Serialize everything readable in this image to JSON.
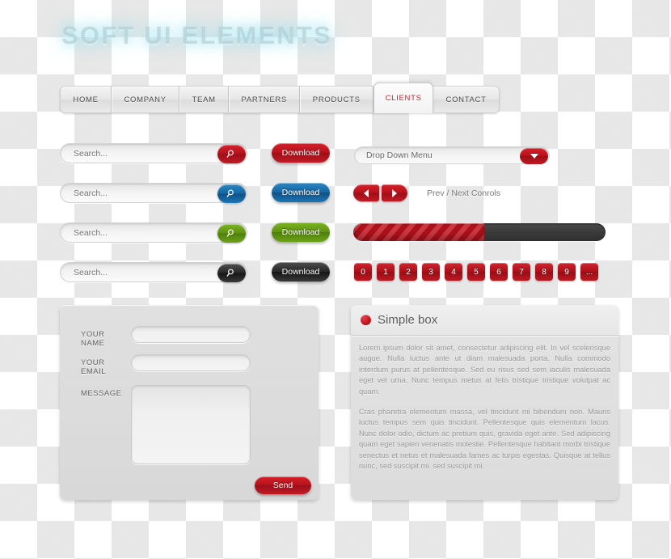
{
  "page": {
    "title": "SOFT UI ELEMENTS"
  },
  "nav": {
    "items": [
      {
        "label": "HOME",
        "active": false
      },
      {
        "label": "COMPANY",
        "active": false
      },
      {
        "label": "TEAM",
        "active": false
      },
      {
        "label": "PARTNERS",
        "active": false
      },
      {
        "label": "PRODUCTS",
        "active": false
      },
      {
        "label": "CLIENTS",
        "active": true
      },
      {
        "label": "CONTACT",
        "active": false
      }
    ]
  },
  "controls": {
    "search_placeholder": "Search...",
    "search_value": "",
    "rows": [
      {
        "color_name": "red",
        "color": "#b4121c",
        "download_label": "Download",
        "search_icon": "magnifier-icon"
      },
      {
        "color_name": "blue",
        "color": "#1565a0",
        "download_label": "Download",
        "search_icon": "magnifier-icon"
      },
      {
        "color_name": "green",
        "color": "#5e9112",
        "download_label": "Download",
        "search_icon": "magnifier-icon"
      },
      {
        "color_name": "black",
        "color": "#272727",
        "download_label": "Download",
        "search_icon": "magnifier-icon"
      }
    ]
  },
  "dropdown": {
    "label": "Drop Down Menu",
    "arrow_icon": "chevron-down-icon"
  },
  "prev_next": {
    "label": "Prev / Next Conrols",
    "prev_icon": "triangle-left-icon",
    "next_icon": "triangle-right-icon"
  },
  "progress": {
    "percent": 52,
    "fill_color": "#c1131d",
    "track_color": "#3a3a3a"
  },
  "pagination": {
    "pages": [
      "0",
      "1",
      "2",
      "3",
      "4",
      "5",
      "6",
      "7",
      "8",
      "9",
      "..."
    ],
    "color": "#ad1018"
  },
  "form": {
    "name_label": "YOUR NAME",
    "name_value": "",
    "email_label": "YOUR EMAIL",
    "email_value": "",
    "message_label": "MESSAGE",
    "message_value": "",
    "send_label": "Send"
  },
  "simple_box": {
    "dot_icon": "red-circle-icon",
    "title": "Simple box",
    "paragraphs": [
      "Lorem ipsum dolor sit amet, consectetur adipiscing elit. In vel scelerisque augue. Nulla luctus ante ut diam malesuada porta. Nulla commodo interdum purus at pellentesque. Sed eu risus sed sem iaculis malesuada eget vel urna. Nunc tempus metus at felis tristique tristique volutpat ac quam.",
      "Cras pharetra elementum massa, vel tincidunt mi bibendum non. Mauris luctus tempus sem quis tincidunt. Pellentesque quis elementum lacus. Nunc dolor odio, dictum ac pretium quis, gravida eget ante. Sed adipiscing quam eget sapien venenatis molestie. Pellentesque habitant morbi tristique senectus et netus et malesuada fames ac turpis egestas. Quisque at tellus nunc, sed suscipit mi. sed suscipit mi."
    ]
  }
}
